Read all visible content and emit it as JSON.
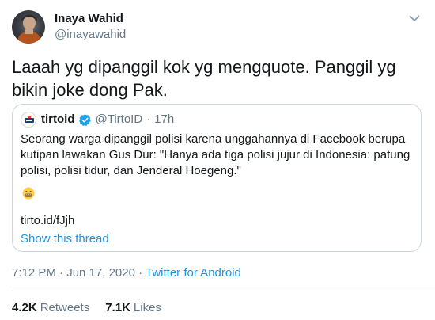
{
  "author": {
    "display_name": "Inaya Wahid",
    "handle": "@inayawahid"
  },
  "tweet": {
    "text": "Laaah yg dipanggil kok yg mengquote. Panggil yg bikin joke dong Pak."
  },
  "quoted": {
    "name": "tirtoid",
    "handle": "@TirtoID",
    "separator": "·",
    "time": "17h",
    "text": "Seorang warga dipanggil polisi karena unggahannya di Facebook berupa kutipan lawakan Gus Dur: \"Hanya ada tiga polisi jujur di Indonesia: patung polisi, polisi tidur, dan Jenderal Hoegeng.\"",
    "emoji_icon": "grimacing-face-icon",
    "link": "tirto.id/fJjh",
    "show_thread": "Show this thread"
  },
  "meta": {
    "timestamp": "7:12 PM · Jun 17, 2020 · ",
    "source": "Twitter for Android"
  },
  "stats": {
    "retweets_count": "4.2K",
    "retweets_label": "Retweets",
    "likes_count": "7.1K",
    "likes_label": "Likes"
  },
  "colors": {
    "link_blue": "#1b95e0",
    "secondary_text": "#657786",
    "verified_blue": "#1da1f2",
    "border": "#ccd6dd"
  }
}
